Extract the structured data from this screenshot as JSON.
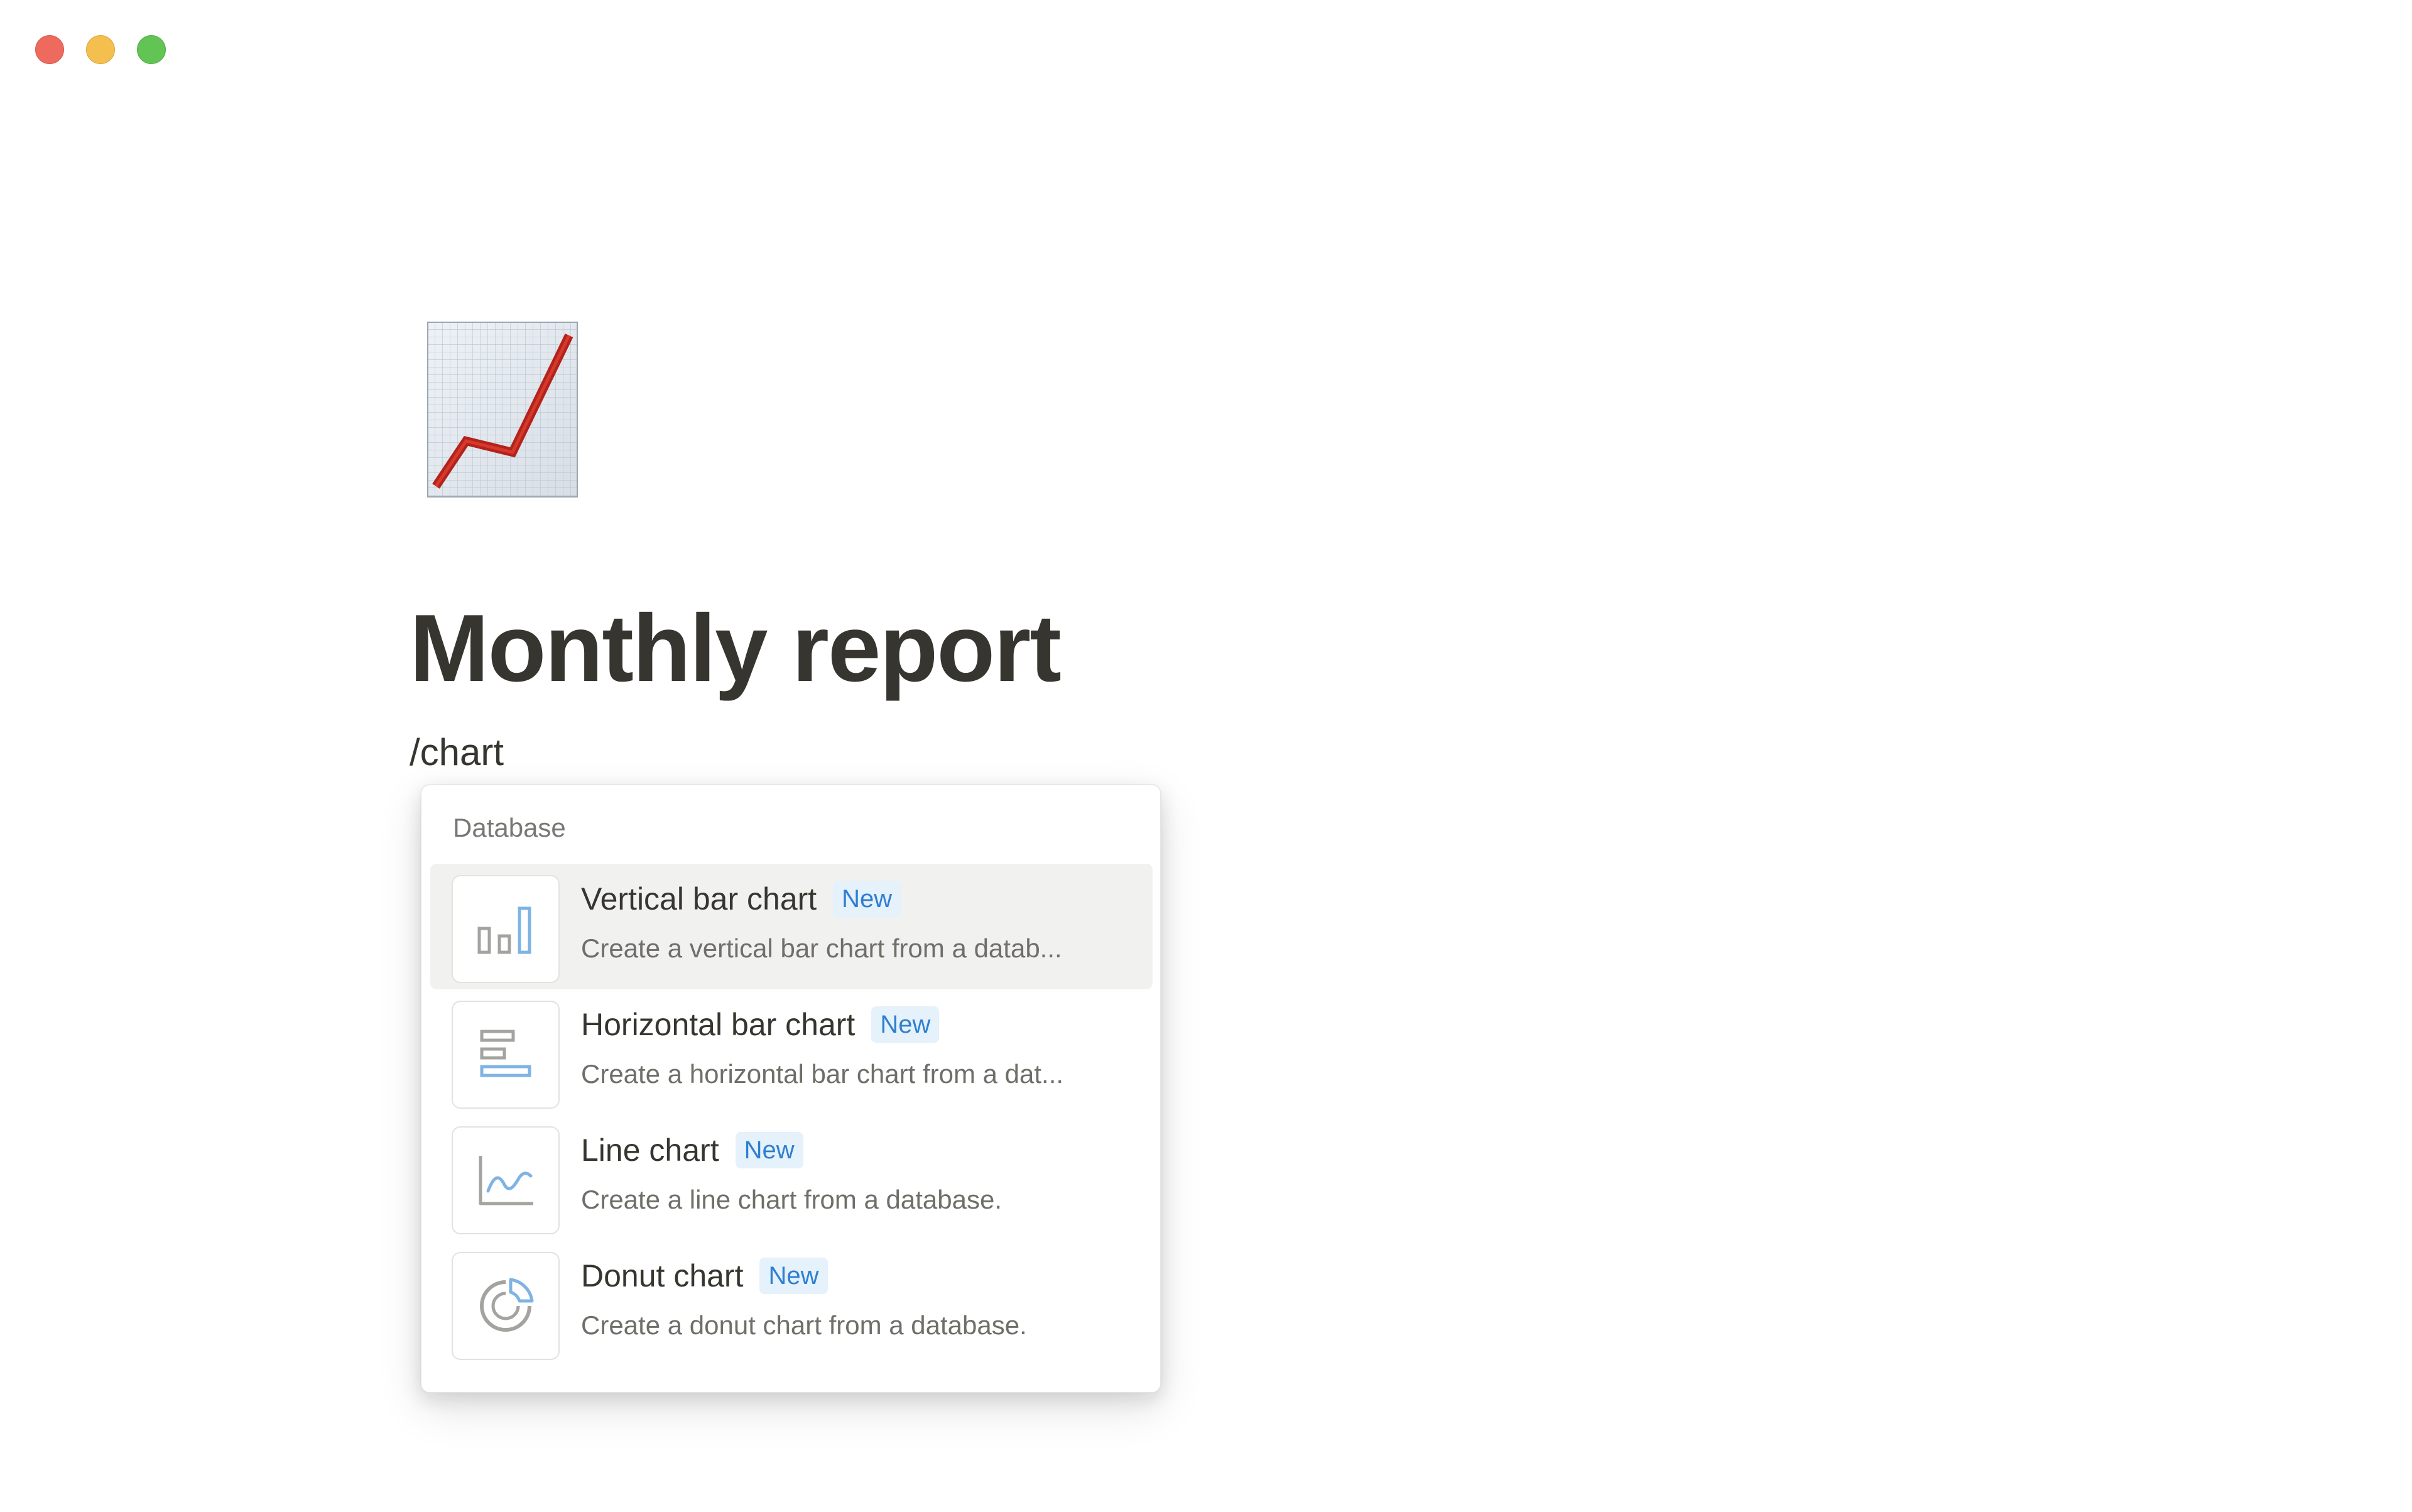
{
  "window": {
    "controls": [
      "close",
      "minimize",
      "maximize"
    ],
    "colors": {
      "close": "#ee6a5e",
      "minimize": "#f5bf4f",
      "maximize": "#61c454"
    }
  },
  "page": {
    "icon": "chart-increasing-icon",
    "title": "Monthly report",
    "command_text": "/chart"
  },
  "menu": {
    "section_label": "Database",
    "accent_color": "#2f7fd1",
    "items": [
      {
        "title": "Vertical bar chart",
        "badge": "New",
        "description": "Create a vertical bar chart from a datab...",
        "icon": "vertical-bar-chart-icon",
        "selected": true
      },
      {
        "title": "Horizontal bar chart",
        "badge": "New",
        "description": "Create a horizontal bar chart from a dat...",
        "icon": "horizontal-bar-chart-icon",
        "selected": false
      },
      {
        "title": "Line chart",
        "badge": "New",
        "description": "Create a line chart from a database.",
        "icon": "line-chart-icon",
        "selected": false
      },
      {
        "title": "Donut chart",
        "badge": "New",
        "description": "Create a donut chart from a database.",
        "icon": "donut-chart-icon",
        "selected": false
      }
    ]
  }
}
